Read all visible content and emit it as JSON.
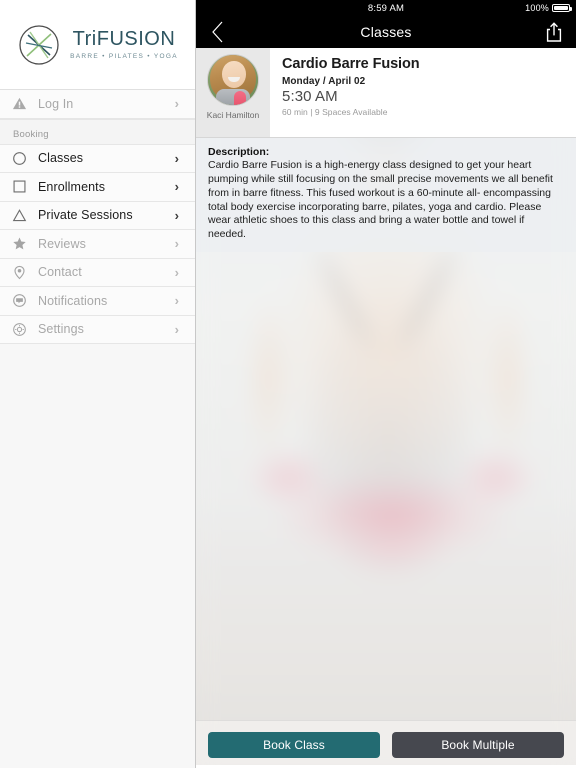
{
  "sidebar": {
    "brand": {
      "name": "TriFUSION",
      "tagline": "BARRE • PILATES • YOGA",
      "logo_icon": "trifusion-circle-logo"
    },
    "top_items": [
      {
        "label": "Log In",
        "icon": "warning-triangle-icon",
        "active": false,
        "chevron": "›"
      }
    ],
    "section_label": "Booking",
    "items": [
      {
        "label": "Classes",
        "icon": "circle-icon",
        "active": true,
        "chevron": "›"
      },
      {
        "label": "Enrollments",
        "icon": "square-icon",
        "active": true,
        "chevron": "›"
      },
      {
        "label": "Private Sessions",
        "icon": "triangle-icon",
        "active": true,
        "chevron": "›"
      },
      {
        "label": "Reviews",
        "icon": "star-icon",
        "active": false,
        "chevron": "›"
      },
      {
        "label": "Contact",
        "icon": "location-pin-icon",
        "active": false,
        "chevron": "›"
      },
      {
        "label": "Notifications",
        "icon": "chat-bubble-icon",
        "active": false,
        "chevron": "›"
      },
      {
        "label": "Settings",
        "icon": "gear-icon",
        "active": false,
        "chevron": "›"
      }
    ]
  },
  "status_bar": {
    "time": "8:59 AM",
    "battery_percent": "100%",
    "battery_icon": "battery-full-icon"
  },
  "nav_bar": {
    "title": "Classes",
    "back_icon": "chevron-left-icon",
    "share_icon": "share-icon"
  },
  "class_card": {
    "instructor_name": "Kaci Hamilton",
    "instructor_avatar_icon": "instructor-avatar",
    "title": "Cardio Barre Fusion",
    "date": "Monday / April 02",
    "time": "5:30 AM",
    "meta": "60 min | 9 Spaces Available"
  },
  "description": {
    "label": "Description:",
    "text": "Cardio Barre Fusion is a high-energy class designed to get your heart pumping while still focusing on the small precise movements we all benefit from in barre fitness. This fused workout is a 60-minute all- encompassing total body exercise incorporating barre, pilates, yoga and cardio. Please wear athletic shoes to this class and bring a water bottle and towel if needed."
  },
  "actions": {
    "book_class_label": "Book Class",
    "book_multiple_label": "Book Multiple"
  },
  "colors": {
    "brand_teal": "#2e5561",
    "primary_button": "#236b72",
    "secondary_button": "#46484f",
    "statusbar_black": "#000000"
  }
}
